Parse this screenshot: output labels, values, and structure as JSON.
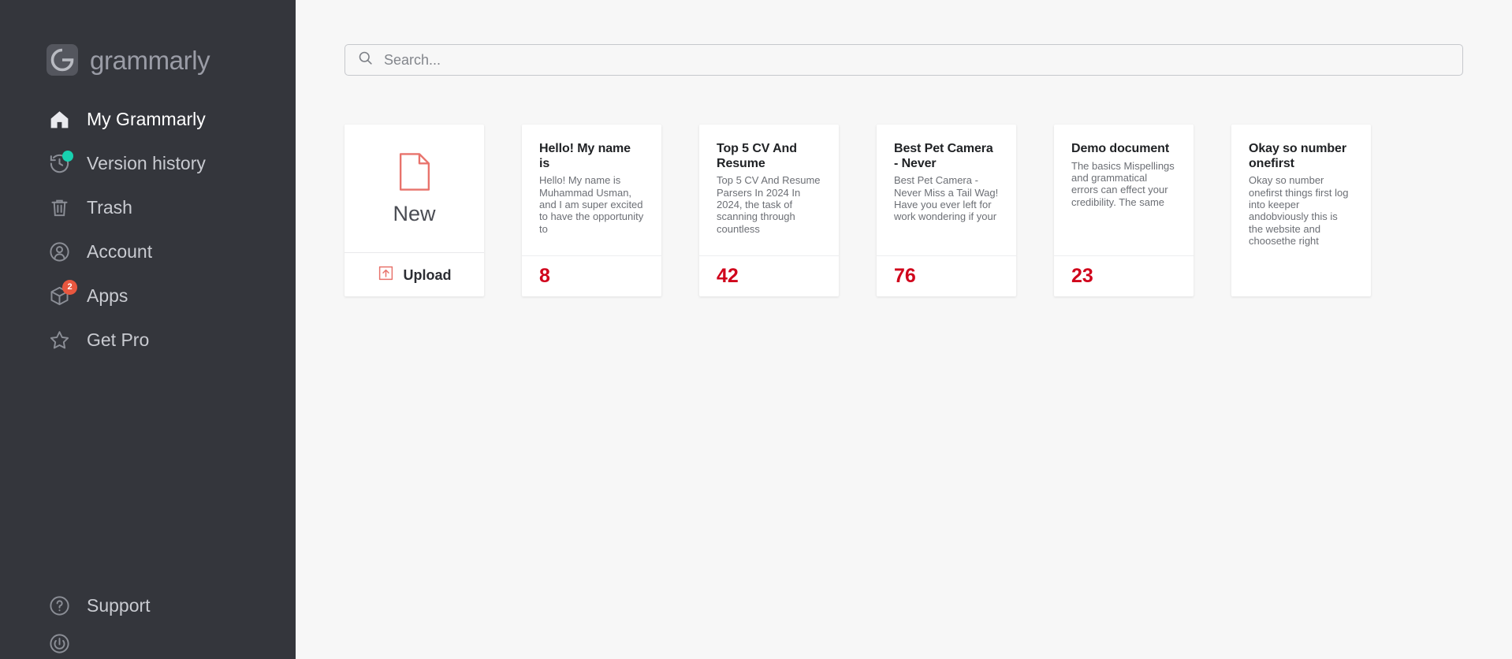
{
  "brand": {
    "logo_icon": "grammarly-logo-icon",
    "wordmark": "grammarly",
    "logo_color": "#8e9099",
    "accent_red": "#d0021b",
    "accent_coral": "#e8573f",
    "accent_teal": "#18d1b0",
    "sidebar_bg": "#34363c",
    "main_bg": "#f7f7f7"
  },
  "sidebar": {
    "items": [
      {
        "label": "My Grammarly",
        "icon": "home-icon",
        "active": true,
        "badge": null
      },
      {
        "label": "Version history",
        "icon": "clock-rewind-icon",
        "active": false,
        "badge": "dot"
      },
      {
        "label": "Trash",
        "icon": "trash-icon",
        "active": false,
        "badge": null
      },
      {
        "label": "Account",
        "icon": "user-circle-icon",
        "active": false,
        "badge": null
      },
      {
        "label": "Apps",
        "icon": "cube-icon",
        "active": false,
        "badge": "2"
      },
      {
        "label": "Get Pro",
        "icon": "star-icon",
        "active": false,
        "badge": null
      }
    ],
    "bottom_items": [
      {
        "label": "Support",
        "icon": "question-circle-icon"
      },
      {
        "label": "",
        "icon": "power-icon"
      }
    ]
  },
  "search": {
    "icon": "search-icon",
    "placeholder": "Search...",
    "value": ""
  },
  "new_card": {
    "icon": "new-document-icon",
    "label": "New",
    "upload_icon": "upload-icon",
    "upload_label": "Upload"
  },
  "documents": [
    {
      "title": "Hello! My name is",
      "snippet": "Hello! My name is Muhammad Usman, and I am super excited to have the opportunity to",
      "score": "8"
    },
    {
      "title": "Top 5 CV And Resume",
      "snippet": "Top 5 CV And Resume Parsers In 2024 In 2024, the task of scanning through countless",
      "score": "42"
    },
    {
      "title": "Best Pet Camera - Never",
      "snippet": "Best Pet Camera - Never Miss a Tail Wag! Have you ever left for work wondering if your",
      "score": "76"
    },
    {
      "title": "Demo document",
      "snippet": "The basics Mispellings and grammatical errors can effect your credibility. The same",
      "score": "23"
    },
    {
      "title": "Okay so number onefirst",
      "snippet": "Okay so number onefirst things first log into keeper andobviously this is the website and choosethe right",
      "score": ""
    }
  ]
}
